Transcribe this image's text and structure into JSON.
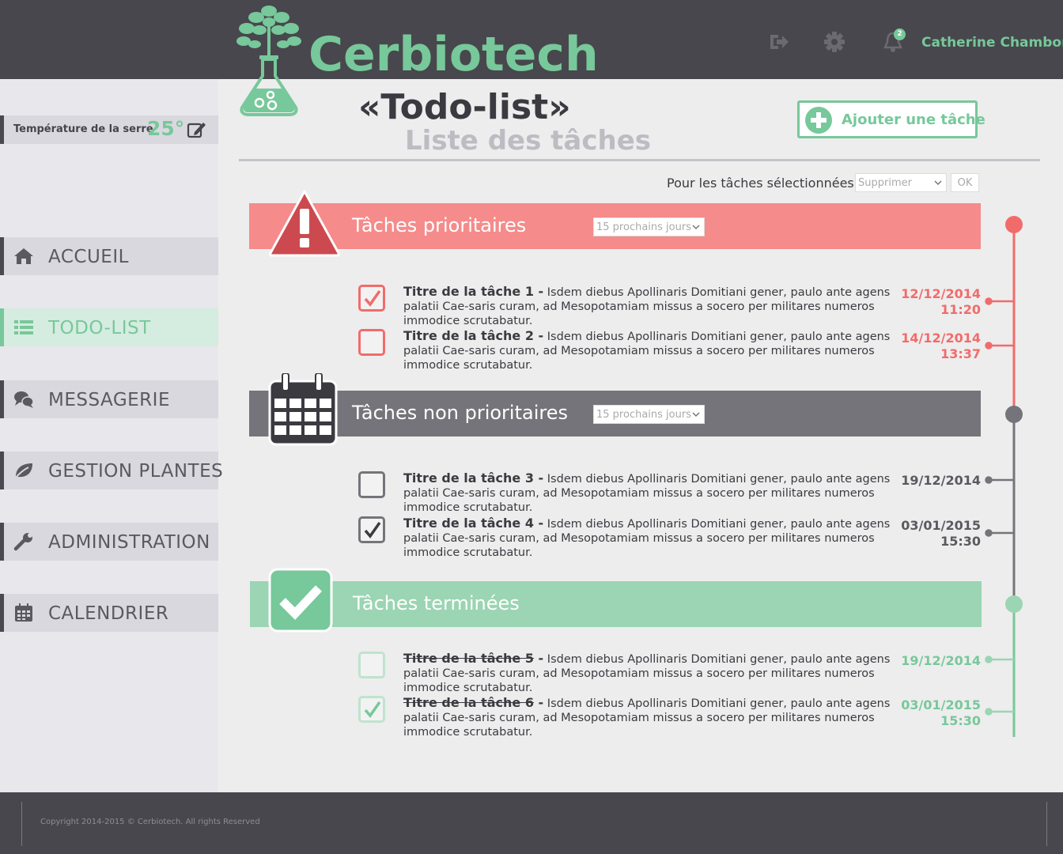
{
  "app": {
    "brand": "Cerbiotech"
  },
  "header": {
    "user_name": "Catherine Chambon",
    "notifications_count": "2",
    "icons": [
      "logout-icon",
      "gear-icon",
      "bell-icon"
    ]
  },
  "sidebar": {
    "temperature": {
      "label": "Température de la serre",
      "value": "25°"
    },
    "items": [
      {
        "label": "ACCUEIL",
        "icon": "home-icon",
        "active": false
      },
      {
        "label": "TODO-LIST",
        "icon": "list-icon",
        "active": true
      },
      {
        "label": "MESSAGERIE",
        "icon": "chat-icon",
        "active": false
      },
      {
        "label": "GESTION PLANTES",
        "icon": "leaf-icon",
        "active": false
      },
      {
        "label": "ADMINISTRATION",
        "icon": "wrench-icon",
        "active": false
      },
      {
        "label": "CALENDRIER",
        "icon": "calendar-icon",
        "active": false
      }
    ]
  },
  "main": {
    "title": "«Todo-list»",
    "subtitle": "Liste des tâches",
    "add_button": "Ajouter une tâche",
    "bulk": {
      "label": "Pour les tâches sélectionnées :",
      "selected": "Supprimer",
      "ok": "OK"
    },
    "sections": [
      {
        "title": "Tâches prioritaires",
        "filter": "15 prochains jours",
        "color": "#f58b8b",
        "tasks": [
          {
            "title": "Titre de la tâche 1 -",
            "text": "Isdem diebus Apollinaris Domitiani gener, paulo ante agens palatii Cae-saris curam, ad Mesopotamiam missus a socero per militares numeros immodice scrutabatur.",
            "date": "12/12/2014",
            "time": "11:20",
            "checked": true
          },
          {
            "title": "Titre de la tâche 2 -",
            "text": "Isdem diebus Apollinaris Domitiani gener, paulo ante agens palatii Cae-saris curam, ad Mesopotamiam missus a socero per militares numeros immodice scrutabatur.",
            "date": "14/12/2014",
            "time": "13:37",
            "checked": false
          }
        ]
      },
      {
        "title": "Tâches non prioritaires",
        "filter": "15 prochains jours",
        "color": "#75747a",
        "tasks": [
          {
            "title": "Titre de la tâche 3 -",
            "text": "Isdem diebus Apollinaris Domitiani gener, paulo ante agens palatii Cae-saris curam, ad Mesopotamiam missus a socero per militares numeros immodice scrutabatur.",
            "date": "19/12/2014",
            "time": "",
            "checked": false
          },
          {
            "title": "Titre de la tâche 4 -",
            "text": "Isdem diebus Apollinaris Domitiani gener, paulo ante agens palatii Cae-saris curam, ad Mesopotamiam missus a socero per militares numeros immodice scrutabatur.",
            "date": "03/01/2015",
            "time": "15:30",
            "checked": true
          }
        ]
      },
      {
        "title": "Tâches terminées",
        "color": "#9bd5b3",
        "tasks": [
          {
            "title": "Titre de la tâche 5",
            "title_suffix": " -",
            "text": "Isdem diebus Apollinaris Domitiani gener, paulo ante agens palatii Cae-saris curam, ad Mesopotamiam missus a socero per militares numeros immodice scrutabatur.",
            "date": "19/12/2014",
            "time": "",
            "checked": false
          },
          {
            "title": "Titre de la tâche 6",
            "title_suffix": " -",
            "text": "Isdem diebus Apollinaris Domitiani gener, paulo ante agens palatii Cae-saris curam, ad Mesopotamiam missus a socero per militares numeros immodice scrutabatur.",
            "date": "03/01/2015",
            "time": "15:30",
            "checked": true
          }
        ]
      }
    ]
  },
  "colors": {
    "green": "#77c89a",
    "red": "#f26b6b",
    "dark": "#48474d",
    "grey": "#75747a"
  },
  "footer": {
    "copyright": "Copyright 2014-2015 © Cerbiotech. All rights Reserved"
  }
}
